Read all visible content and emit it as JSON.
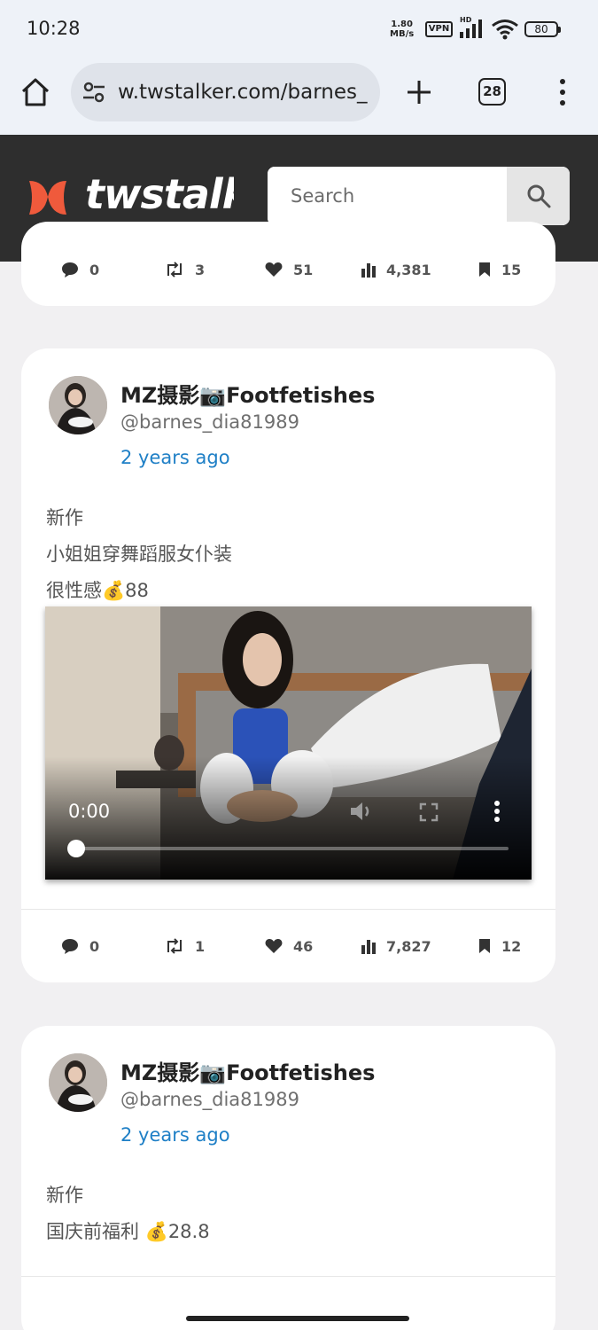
{
  "status_bar": {
    "time": "10:28",
    "net_speed_value": "1.80",
    "net_speed_unit": "MB/s",
    "vpn_label": "VPN",
    "hd_label": "HD",
    "battery_level": "80"
  },
  "browser": {
    "url": "w.twstalker.com/barnes_",
    "tab_count": "28"
  },
  "site": {
    "brand_name": "twstalk",
    "brand_color": "#ef5a3c",
    "search_placeholder": "Search"
  },
  "top_card": {
    "stats": {
      "replies": "0",
      "retweets": "3",
      "likes": "51",
      "views": "4,381",
      "bookmarks": "15"
    }
  },
  "posts": [
    {
      "display_name": "MZ摄影📷Footfetishes",
      "username": "@barnes_dia81989",
      "time": "2 years ago",
      "lines": [
        "新作",
        "小姐姐穿舞蹈服女仆装",
        "很性感💰88"
      ],
      "video": {
        "current_time": "0:00",
        "progress": 0
      },
      "stats": {
        "replies": "0",
        "retweets": "1",
        "likes": "46",
        "views": "7,827",
        "bookmarks": "12"
      }
    },
    {
      "display_name": "MZ摄影📷Footfetishes",
      "username": "@barnes_dia81989",
      "time": "2 years ago",
      "lines": [
        "新作",
        "国庆前福利 💰28.8"
      ]
    }
  ]
}
